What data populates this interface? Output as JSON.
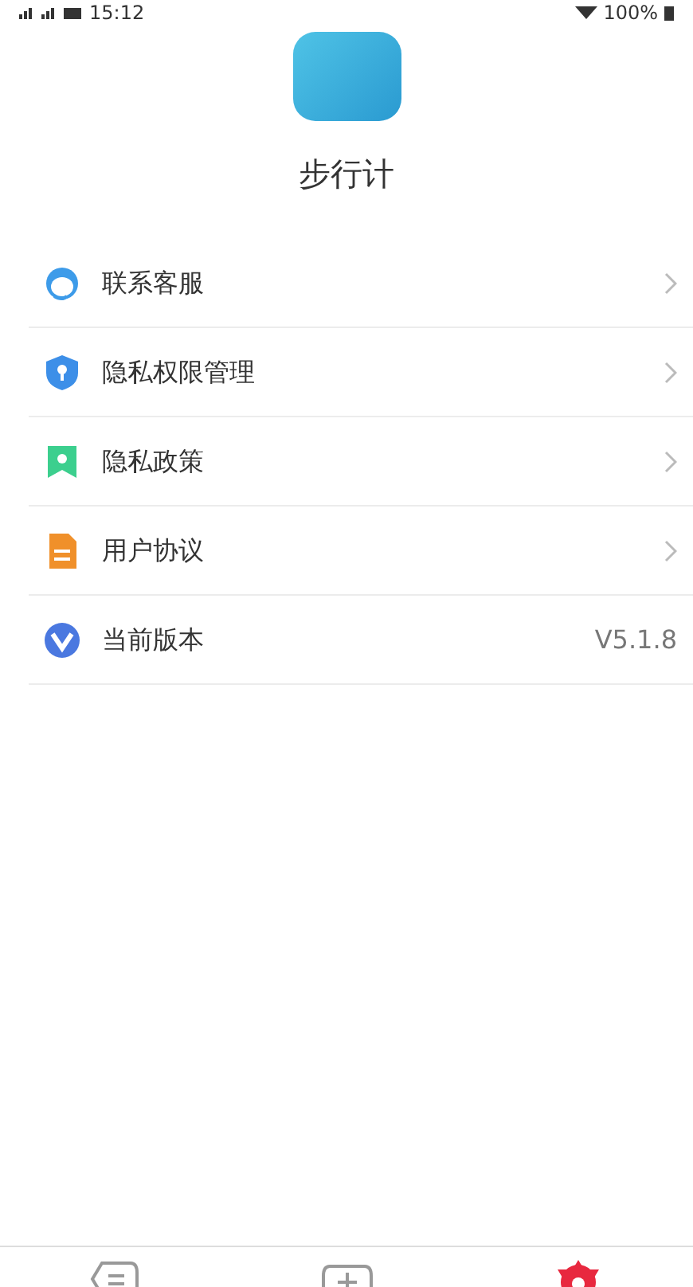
{
  "status_bar": {
    "time": "15:12",
    "battery": "100%"
  },
  "app": {
    "name": "步行计"
  },
  "menu": [
    {
      "label": "联系客服",
      "kind": "link"
    },
    {
      "label": "隐私权限管理",
      "kind": "link"
    },
    {
      "label": "隐私政策",
      "kind": "link"
    },
    {
      "label": "用户协议",
      "kind": "link"
    },
    {
      "label": "当前版本",
      "kind": "value",
      "value": "V5.1.8"
    }
  ],
  "bottom_nav": [
    {
      "selected": false
    },
    {
      "selected": false
    },
    {
      "selected": true
    }
  ]
}
